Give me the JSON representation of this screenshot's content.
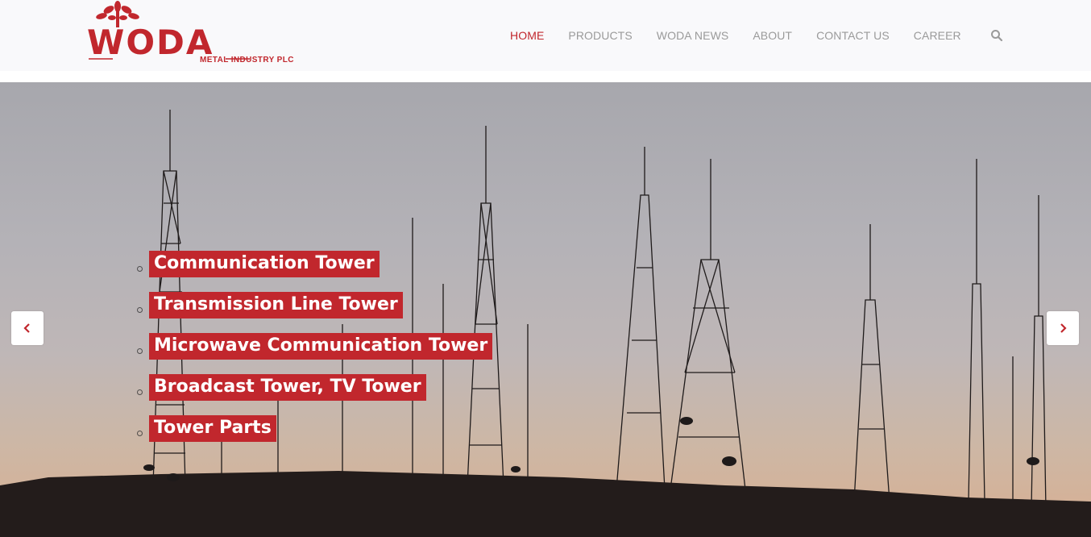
{
  "brand": {
    "logo_text": "WODA",
    "logo_subtitle": "METAL INDUSTRY PLC",
    "accent_color": "#c1272d"
  },
  "nav": {
    "items": [
      {
        "label": "HOME",
        "active": true
      },
      {
        "label": "PRODUCTS",
        "active": false
      },
      {
        "label": "WODA NEWS",
        "active": false
      },
      {
        "label": "ABOUT",
        "active": false
      },
      {
        "label": "CONTACT US",
        "active": false
      },
      {
        "label": "CAREER",
        "active": false
      }
    ],
    "search_icon": "search-icon"
  },
  "hero": {
    "slides_items": [
      "Communication Tower",
      "Transmission Line Tower",
      "Microwave Communication Tower",
      "Broadcast Tower, TV Tower",
      "Tower Parts"
    ],
    "prev_icon": "chevron-left-icon",
    "next_icon": "chevron-right-icon"
  }
}
